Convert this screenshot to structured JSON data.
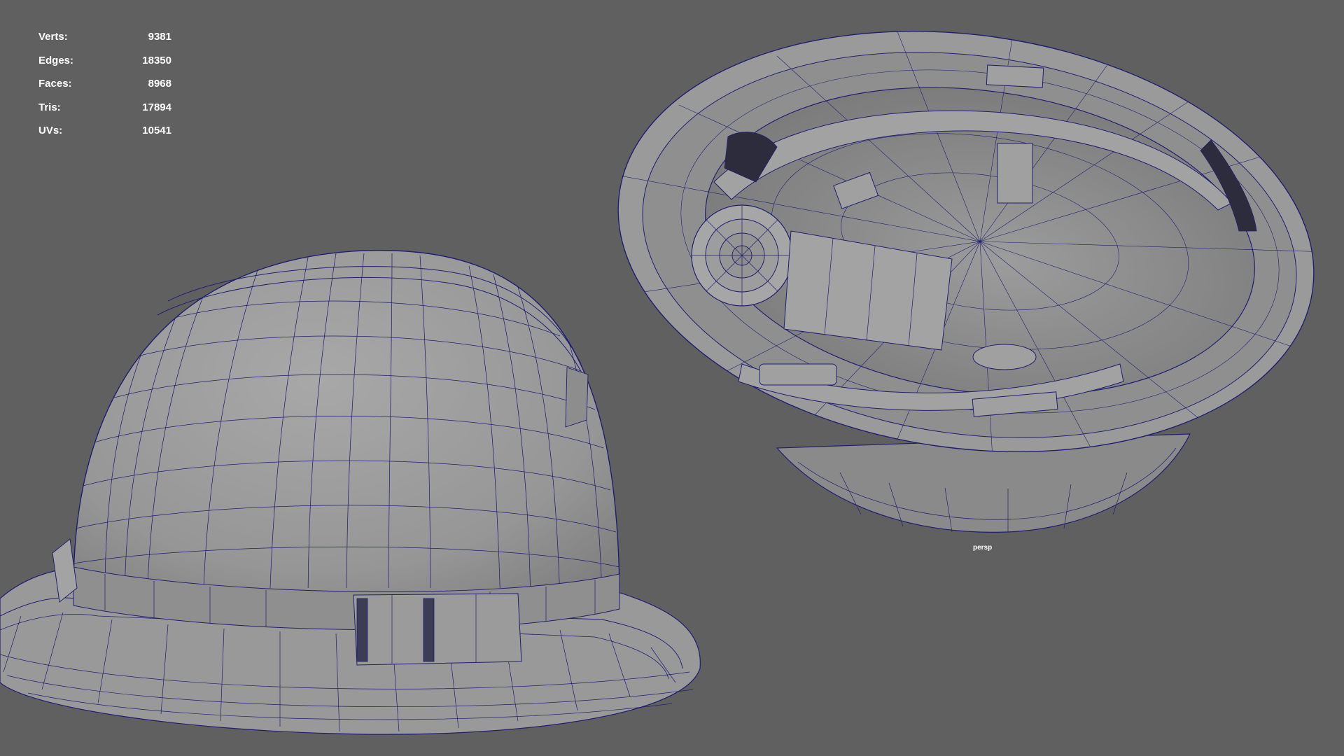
{
  "viewport": {
    "camera_label": "persp",
    "background_color": "#606060",
    "wire_color": "#1f1f6e",
    "shade_color": "#9a9a9a"
  },
  "hud": {
    "rows": [
      {
        "label": "Verts:",
        "value": "9381"
      },
      {
        "label": "Edges:",
        "value": "18350"
      },
      {
        "label": "Faces:",
        "value": "8968"
      },
      {
        "label": "Tris:",
        "value": "17894"
      },
      {
        "label": "UVs:",
        "value": "10541"
      }
    ]
  },
  "objects": [
    {
      "name": "hard-hat-exterior"
    },
    {
      "name": "hard-hat-interior"
    }
  ]
}
